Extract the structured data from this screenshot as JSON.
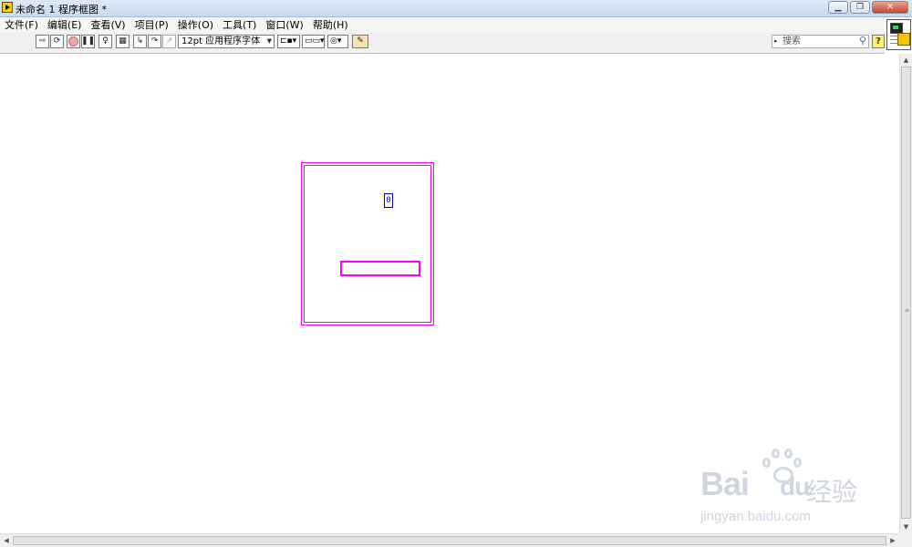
{
  "window": {
    "title": "未命名 1 程序框图 *",
    "controls": [
      "minimize-icon",
      "maximize-icon",
      "close-icon"
    ]
  },
  "menu": {
    "items": [
      "文件(F)",
      "编辑(E)",
      "查看(V)",
      "项目(P)",
      "操作(O)",
      "工具(T)",
      "窗口(W)",
      "帮助(H)"
    ]
  },
  "toolbar": {
    "buttons": [
      "run-icon",
      "run-continuously-icon",
      "abort-icon",
      "pause-icon",
      "highlight-execution-icon",
      "retain-wire-values-icon",
      "step-into-icon",
      "step-over-icon",
      "step-out-icon"
    ],
    "font": "12pt 应用程序字体",
    "align_icon": "align-objects-icon",
    "distribute_icon": "distribute-objects-icon",
    "reorder_icon": "reorder-icon",
    "cleanup_icon": "clean-up-diagram-icon",
    "search_placeholder": "搜索",
    "help_icon": "context-help-icon"
  },
  "vi_icon": "vi-icon",
  "diagram": {
    "loop_structure": "for-loop",
    "numeric_constant": "0",
    "string_constant": "",
    "wire_color": "#ff00ff",
    "numeric_color": "#0000cc"
  },
  "watermark": {
    "brand": "Bai",
    "brand_tail": "du",
    "brand_cn": "经验",
    "url": "jingyan.baidu.com"
  }
}
